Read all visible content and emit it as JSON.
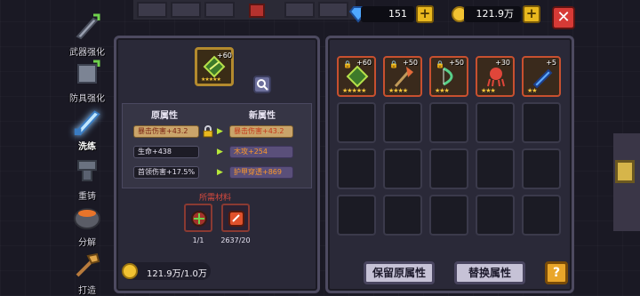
{
  "nav": {
    "items": [
      {
        "label": "武器强化",
        "icon": "sword-upgrade-icon",
        "active": false
      },
      {
        "label": "防具强化",
        "icon": "armor-upgrade-icon",
        "active": false
      },
      {
        "label": "洗练",
        "icon": "refine-sword-icon",
        "active": true
      },
      {
        "label": "重铸",
        "icon": "anvil-icon",
        "active": false
      },
      {
        "label": "分解",
        "icon": "forge-pot-icon",
        "active": false
      },
      {
        "label": "打造",
        "icon": "hammer-icon",
        "active": false
      }
    ]
  },
  "currency": {
    "gems": "151",
    "gold": "121.9万",
    "plus_label": "+",
    "close_label": "✕"
  },
  "item": {
    "level": "+60",
    "stars": "★★★★★",
    "icon": "green-leaf-relic-icon"
  },
  "attributes": {
    "old_title": "原属性",
    "new_title": "新属性",
    "old": [
      "暴击伤害+43.2",
      "生命+438",
      "首领伤害+17.5%"
    ],
    "new": [
      "暴击伤害+43.2",
      "木攻+254",
      "护甲穿透+869"
    ],
    "arrow": "▶",
    "locked_row": 0
  },
  "materials": {
    "title": "所需材料",
    "items": [
      {
        "icon": "relic-material-icon",
        "count": "1/1"
      },
      {
        "icon": "refine-stone-icon",
        "count": "2637/20"
      }
    ]
  },
  "gold_cost": "121.9万/1.0万",
  "inventory": {
    "slots": [
      {
        "level": "+60",
        "stars": "★★★★★",
        "icon": "green-leaf-relic-icon",
        "locked": true
      },
      {
        "level": "+50",
        "stars": "★★★★",
        "icon": "battle-axe-icon",
        "locked": true
      },
      {
        "level": "+50",
        "stars": "★★★",
        "icon": "green-bow-icon",
        "locked": true
      },
      {
        "level": "+30",
        "stars": "★★★",
        "icon": "red-octopus-pet-icon",
        "locked": false
      },
      {
        "level": "+5",
        "stars": "★★",
        "icon": "blue-sword-icon",
        "locked": false
      }
    ],
    "empty_rows": 3
  },
  "buttons": {
    "keep": "保留原属性",
    "replace": "替换属性",
    "help": "?"
  },
  "colors": {
    "panel": "#2a2938",
    "gold": "#f1c232",
    "highlight_pill": "#caa46a",
    "new_value": "#ff9a2a",
    "danger": "#d73a36"
  }
}
